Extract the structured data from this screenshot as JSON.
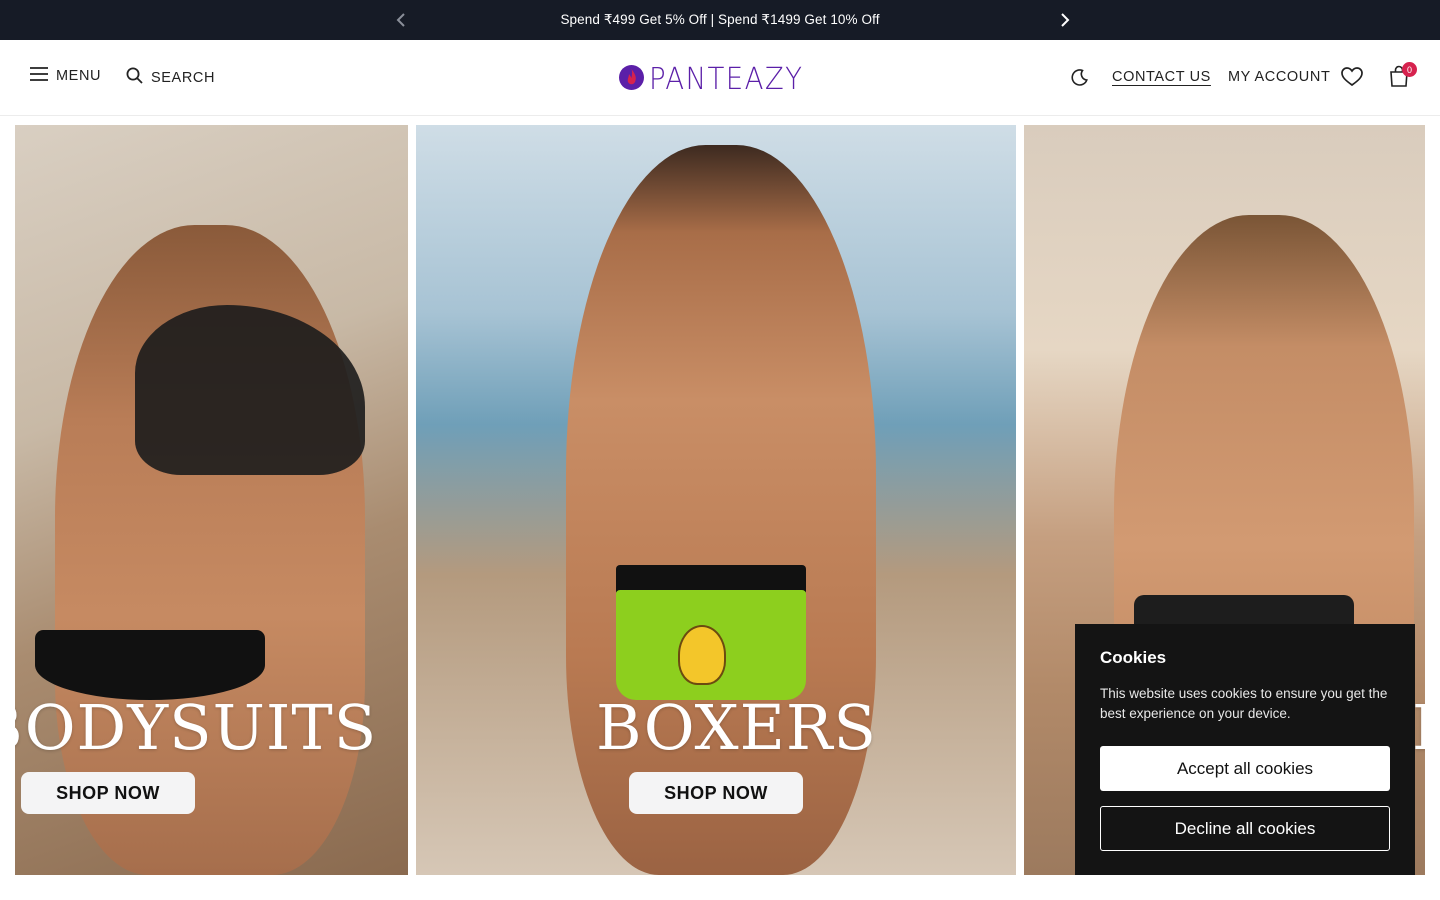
{
  "announcement": {
    "text": "Spend ₹499 Get 5% Off | Spend ₹1499 Get 10% Off",
    "prev_icon": "chevron-left-icon",
    "next_icon": "chevron-right-icon"
  },
  "header": {
    "menu_label": "MENU",
    "search_label": "SEARCH",
    "logo_text": "PANTEAZY",
    "contact_label": "CONTACT US",
    "account_label": "MY ACCOUNT",
    "cart_count": "0",
    "icons": [
      "hamburger-icon",
      "search-icon",
      "moon-icon",
      "heart-icon",
      "shopping-bag-icon"
    ]
  },
  "hero": {
    "panels": [
      {
        "title": "BODYSUITS",
        "cta": "SHOP NOW"
      },
      {
        "title": "BOXERS",
        "cta": "SHOP NOW"
      },
      {
        "title": "BRIEFS"
      }
    ]
  },
  "cookies": {
    "title": "Cookies",
    "text": "This website uses cookies to ensure you get the best experience on your device.",
    "accept_label": "Accept all cookies",
    "decline_label": "Decline all cookies"
  },
  "colors": {
    "announcement_bg": "#161b26",
    "brand_purple": "#5b1fa8",
    "badge_red": "#d6224e",
    "cookie_bg": "#141414"
  }
}
